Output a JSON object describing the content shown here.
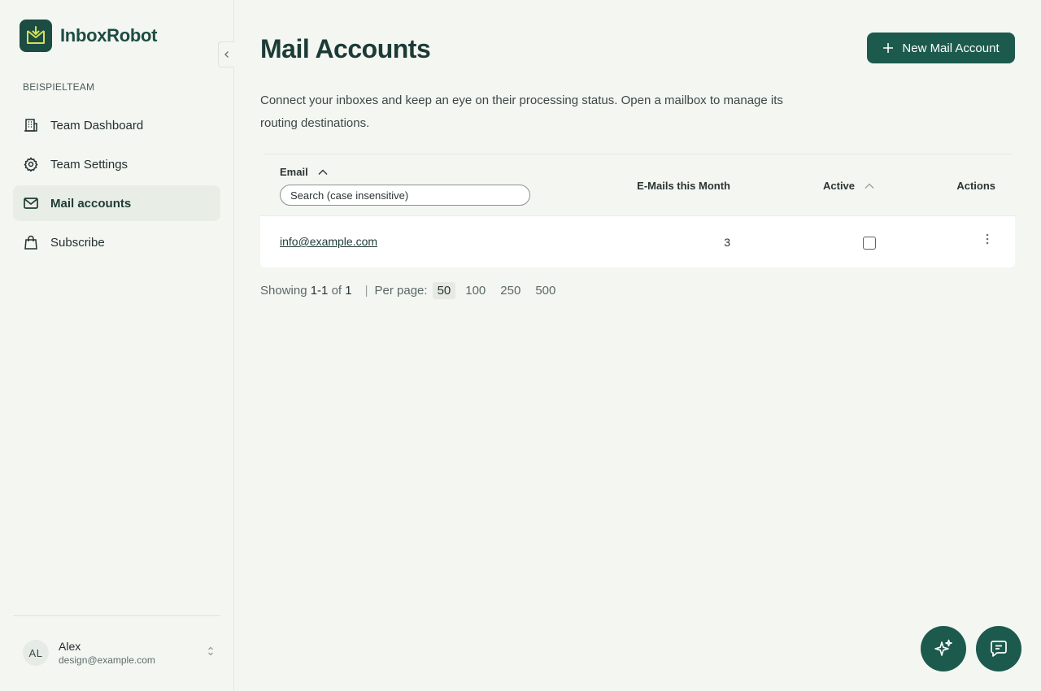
{
  "app": {
    "name": "InboxRobot"
  },
  "sidebar": {
    "team_label": "BEISPIELTEAM",
    "items": [
      {
        "label": "Team Dashboard",
        "icon": "building-icon"
      },
      {
        "label": "Team Settings",
        "icon": "gear-icon"
      },
      {
        "label": "Mail accounts",
        "icon": "mail-icon",
        "active": true
      },
      {
        "label": "Subscribe",
        "icon": "shopping-bag-icon"
      }
    ],
    "user": {
      "initials": "AL",
      "name": "Alex",
      "email": "design@example.com"
    }
  },
  "main": {
    "title": "Mail Accounts",
    "new_button_label": "New Mail Account",
    "description": "Connect your inboxes and keep an eye on their processing status. Open a mailbox to manage its routing destinations.",
    "table": {
      "columns": {
        "email": "Email",
        "mails": "E-Mails this Month",
        "active": "Active",
        "actions": "Actions"
      },
      "search_placeholder": "Search (case insensitive)",
      "rows": [
        {
          "email": "info@example.com",
          "mails_this_month": "3",
          "active": false
        }
      ]
    },
    "pagination": {
      "showing_label": "Showing",
      "range": "1-1",
      "of_label": "of",
      "total": "1",
      "separator": "|",
      "per_page_label": "Per page:",
      "options": [
        "50",
        "100",
        "250",
        "500"
      ],
      "selected": "50"
    }
  },
  "colors": {
    "accent": "#1c5a4d",
    "background": "#f4f6f2",
    "title": "#1c3b37"
  },
  "fabs": [
    {
      "icon": "sparkles-icon"
    },
    {
      "icon": "chat-icon"
    }
  ]
}
